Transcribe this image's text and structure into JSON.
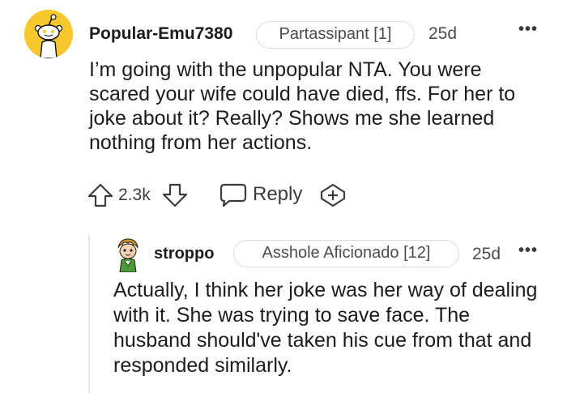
{
  "comments": [
    {
      "username": "Popular-Emu7380",
      "flair": "Partassipant [1]",
      "age": "25d",
      "more": "•••",
      "body": "I’m going with the unpopular NTA. You were scared your wife could have died, ffs. For her to joke about it? Really? Shows me she learned nothing from her actions.",
      "votes": "2.3k",
      "reply_label": "Reply",
      "avatar_color": "#f6c82b"
    },
    {
      "username": "stroppo",
      "flair": "Asshole Aficionado [12]",
      "age": "25d",
      "more": "•••",
      "body": "Actually, I think her joke was her way of dealing with it. She was trying to save face. The husband should've taken his cue from that and responded similarly."
    }
  ],
  "colors": {
    "text": "#1c1c1c",
    "muted": "#4a4c4e",
    "flair_border": "#d9dadc",
    "thread_line": "#e4e5e6"
  },
  "icons": [
    "snoo-avatar-icon",
    "upvote-icon",
    "downvote-icon",
    "reply-bubble-icon",
    "award-icon",
    "more-options-icon",
    "custom-avatar-icon"
  ]
}
